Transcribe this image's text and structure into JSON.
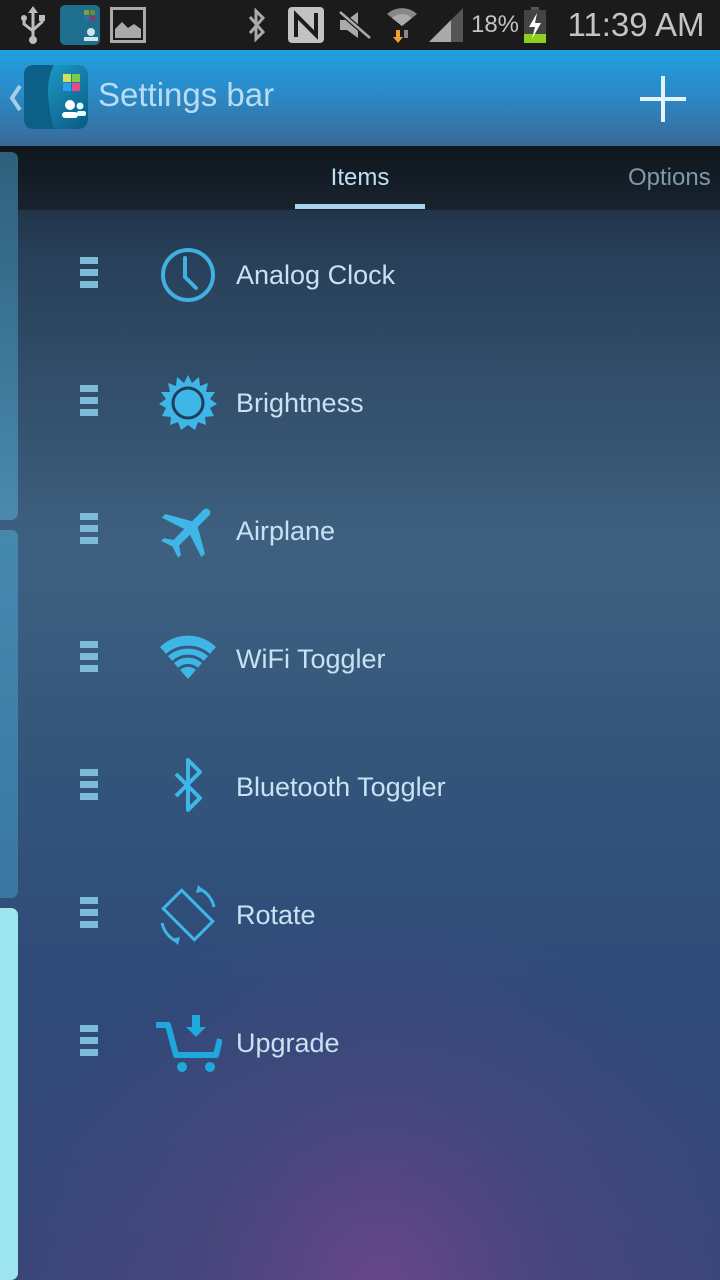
{
  "status_bar": {
    "icons": [
      "usb-icon",
      "app-notification-icon",
      "gallery-icon",
      "bluetooth-icon",
      "nfc-icon",
      "mute-icon",
      "wifi-icon",
      "signal-icon",
      "battery-charging-icon"
    ],
    "battery_percent": "18%",
    "time": "11:39 AM"
  },
  "action_bar": {
    "title": "Settings bar",
    "back_icon": "chevron-left-icon",
    "add_icon": "plus-icon"
  },
  "tabs": [
    {
      "label": "Items",
      "selected": true
    },
    {
      "label": "Options",
      "selected": false
    }
  ],
  "items": [
    {
      "label": "Analog Clock",
      "icon": "clock-icon"
    },
    {
      "label": "Brightness",
      "icon": "sun-icon"
    },
    {
      "label": "Airplane",
      "icon": "airplane-icon"
    },
    {
      "label": "WiFi Toggler",
      "icon": "wifi-icon"
    },
    {
      "label": "Bluetooth Toggler",
      "icon": "bluetooth-icon"
    },
    {
      "label": "Rotate",
      "icon": "rotate-icon"
    },
    {
      "label": "Upgrade",
      "icon": "cart-download-icon"
    }
  ],
  "colors": {
    "accent": "#3fb6e8",
    "action_bar": "#229fe0",
    "side_panel_active": "#9ee6ef"
  }
}
